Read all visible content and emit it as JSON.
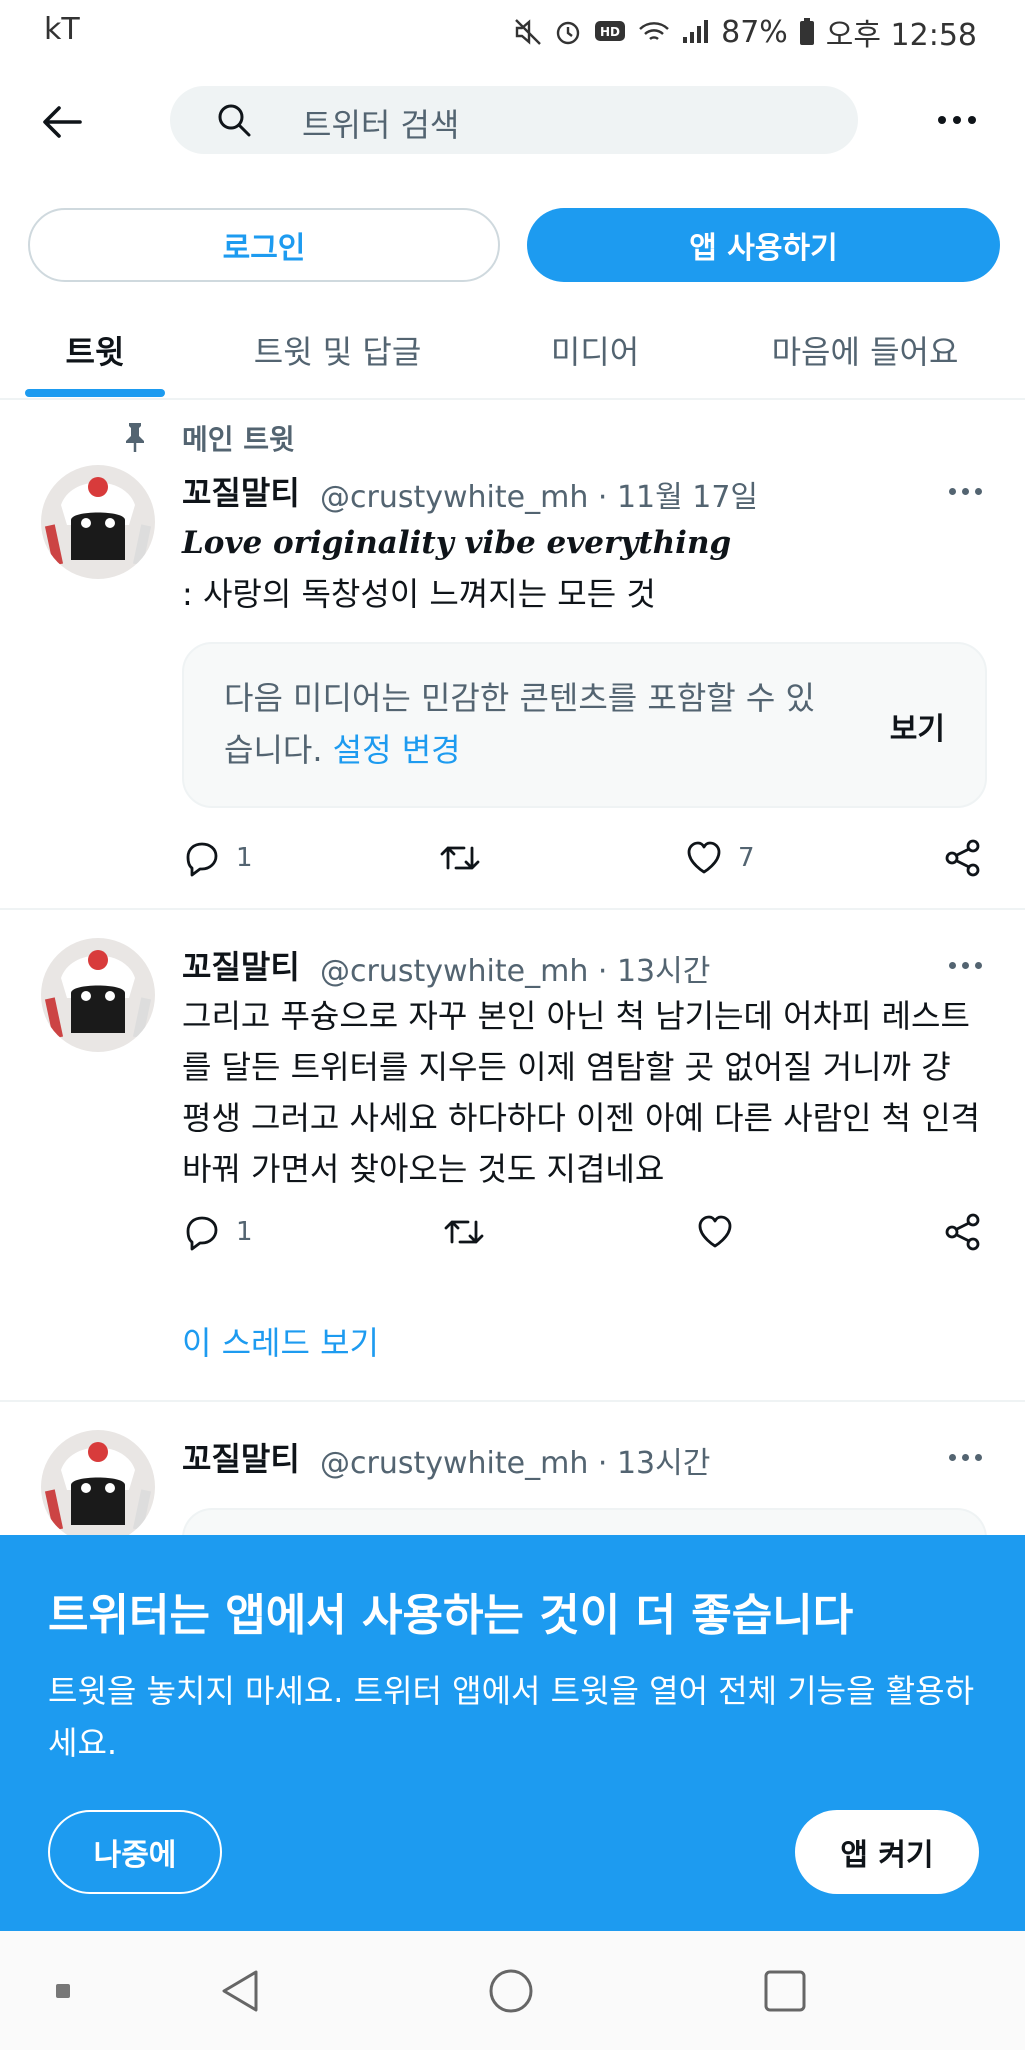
{
  "status_bar": {
    "carrier": "kT",
    "battery": "87%",
    "time": "오후 12:58"
  },
  "search": {
    "placeholder": "트위터 검색"
  },
  "auth": {
    "login_label": "로그인",
    "use_app_label": "앱 사용하기"
  },
  "tabs": [
    {
      "label": "트윗",
      "active": true
    },
    {
      "label": "트윗 및 답글",
      "active": false
    },
    {
      "label": "미디어",
      "active": false
    },
    {
      "label": "마음에 들어요",
      "active": false
    }
  ],
  "tweets": [
    {
      "pinned_label": "메인 트윗",
      "name": "꼬질말티",
      "handle_line": "@crustywhite_mh · 11월 17일",
      "text_line1": "Love originality vibe everything",
      "text_line2": ": 사랑의 독창성이 느껴지는 모든 것",
      "sensitive_text": "다음 미디어는 민감한 콘텐츠를 포함할 수 있습니다.",
      "sensitive_link": "설정 변경",
      "sensitive_view": "보기",
      "replies": "1",
      "likes": "7"
    },
    {
      "name": "꼬질말티",
      "handle_line": "@crustywhite_mh · 13시간",
      "text": "그리고 푸슝으로 자꾸 본인 아닌 척 남기는데 어차피 레스트를 달든 트위터를 지우든 이제 염탐할 곳 없어질 거니까 걍 평생 그러고 사세요 하다하다 이젠 아예 다른 사람인 척 인격 바꿔 가면서 찾아오는 것도 지겹네요",
      "replies": "1",
      "thread_link": "이 스레드 보기"
    },
    {
      "name": "꼬질말티",
      "handle_line": "@crustywhite_mh · 13시간"
    }
  ],
  "prompt": {
    "title": "트위터는 앱에서 사용하는 것이 더 좋습니다",
    "body": "트윗을 놓치지 마세요. 트위터 앱에서 트윗을 열어 전체 기능을 활용하세요.",
    "later_label": "나중에",
    "open_app_label": "앱 켜기"
  },
  "colors": {
    "accent": "#1d9bf0",
    "text_primary": "#0f1419",
    "text_secondary": "#536471",
    "divider": "#eff3f4"
  }
}
